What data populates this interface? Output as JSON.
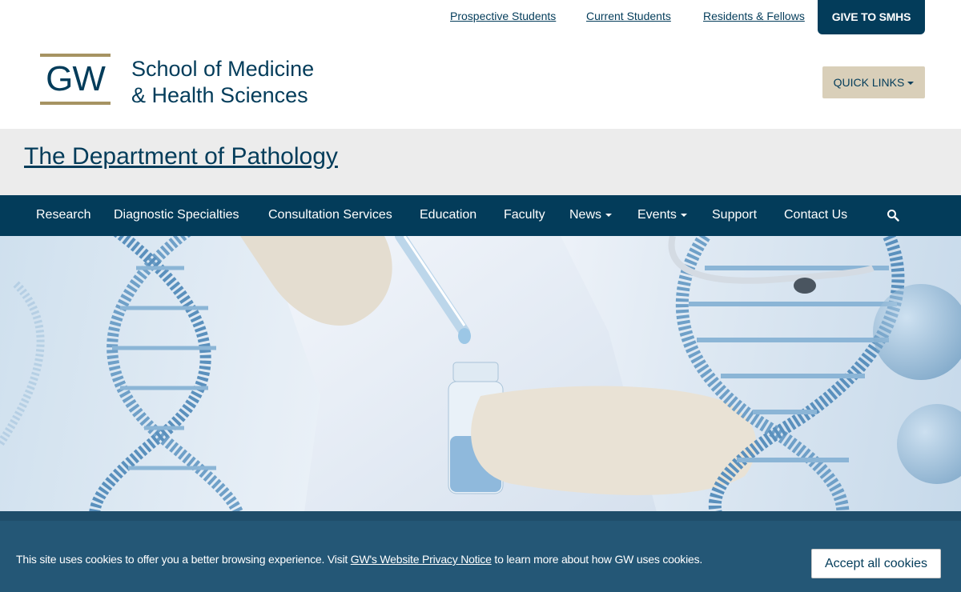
{
  "utility_nav": {
    "links": [
      "Prospective Students",
      "Current Students",
      "Residents & Fellows"
    ],
    "give_label": "GIVE TO SMHS"
  },
  "branding": {
    "logo_text": "GW",
    "school_line1": "School of Medicine",
    "school_line2": "& Health Sciences",
    "quick_links_label": "QUICK LINKS"
  },
  "department": {
    "title": "The Department of Pathology"
  },
  "main_nav": {
    "items": [
      {
        "label": "Research",
        "has_dropdown": false
      },
      {
        "label": "Diagnostic Specialties",
        "has_dropdown": false
      },
      {
        "label": "Consultation Services",
        "has_dropdown": false
      },
      {
        "label": "Education",
        "has_dropdown": false
      },
      {
        "label": "Faculty",
        "has_dropdown": false
      },
      {
        "label": "News",
        "has_dropdown": true
      },
      {
        "label": "Events",
        "has_dropdown": true
      },
      {
        "label": "Support",
        "has_dropdown": false
      },
      {
        "label": "Contact Us",
        "has_dropdown": false
      }
    ],
    "search_icon": "search-icon"
  },
  "cookie_banner": {
    "text_before": "This site uses cookies to offer you a better browsing experience. Visit ",
    "link_text": "GW's Website Privacy Notice",
    "text_after": " to learn more about how GW uses cookies.",
    "accept_label": "Accept all cookies"
  },
  "colors": {
    "primary": "#033c5a",
    "gold": "#a69362",
    "quick_links_bg": "#d9cfb9",
    "cookie_bg": "#245776"
  }
}
